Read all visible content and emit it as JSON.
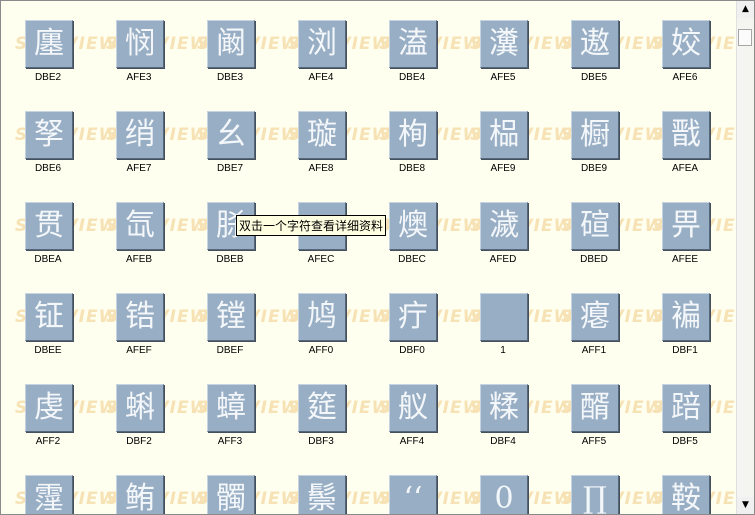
{
  "watermark": "SHX VIEWER",
  "tooltip": "双击一个字符查看详细资料",
  "cells": [
    {
      "char": "廛",
      "code": "DBE2"
    },
    {
      "char": "悯",
      "code": "AFE3"
    },
    {
      "char": "阚",
      "code": "DBE3"
    },
    {
      "char": "浏",
      "code": "AFE4"
    },
    {
      "char": "溘",
      "code": "DBE4"
    },
    {
      "char": "瀵",
      "code": "AFE5"
    },
    {
      "char": "遨",
      "code": "DBE5"
    },
    {
      "char": "姣",
      "code": "AFE6"
    },
    {
      "char": "孥",
      "code": "DBE6"
    },
    {
      "char": "绡",
      "code": "AFE7"
    },
    {
      "char": "幺",
      "code": "DBE7"
    },
    {
      "char": "璇",
      "code": "AFE8"
    },
    {
      "char": "栒",
      "code": "DBE8"
    },
    {
      "char": "榀",
      "code": "AFE9"
    },
    {
      "char": "橱",
      "code": "DBE9"
    },
    {
      "char": "戬",
      "code": "AFEA"
    },
    {
      "char": "贯",
      "code": "DBEA"
    },
    {
      "char": "氙",
      "code": "AFEB"
    },
    {
      "char": "脎",
      "code": "DBEB"
    },
    {
      "char": "",
      "code": "AFEC"
    },
    {
      "char": "燠",
      "code": "DBEC"
    },
    {
      "char": "濊",
      "code": "AFED"
    },
    {
      "char": "碹",
      "code": "DBED"
    },
    {
      "char": "畀",
      "code": "AFEE"
    },
    {
      "char": "钲",
      "code": "DBEE"
    },
    {
      "char": "锆",
      "code": "AFEF"
    },
    {
      "char": "镗",
      "code": "DBEF"
    },
    {
      "char": "鸠",
      "code": "AFF0"
    },
    {
      "char": "疔",
      "code": "DBF0"
    },
    {
      "char": "",
      "code": "1"
    },
    {
      "char": "瘪",
      "code": "AFF1"
    },
    {
      "char": "褊",
      "code": "DBF1"
    },
    {
      "char": "虔",
      "code": "AFF2"
    },
    {
      "char": "蝌",
      "code": "DBF2"
    },
    {
      "char": "蟑",
      "code": "AFF3"
    },
    {
      "char": "筵",
      "code": "DBF3"
    },
    {
      "char": "舣",
      "code": "AFF4"
    },
    {
      "char": "糅",
      "code": "DBF4"
    },
    {
      "char": "醑",
      "code": "AFF5"
    },
    {
      "char": "踣",
      "code": "DBF5"
    },
    {
      "char": "霪",
      "code": ""
    },
    {
      "char": "鲔",
      "code": ""
    },
    {
      "char": "髑",
      "code": ""
    },
    {
      "char": "鬃",
      "code": ""
    },
    {
      "char": "‘‘",
      "code": ""
    },
    {
      "char": "0",
      "code": ""
    },
    {
      "char": "∏",
      "code": ""
    },
    {
      "char": "鞍",
      "code": ""
    }
  ]
}
